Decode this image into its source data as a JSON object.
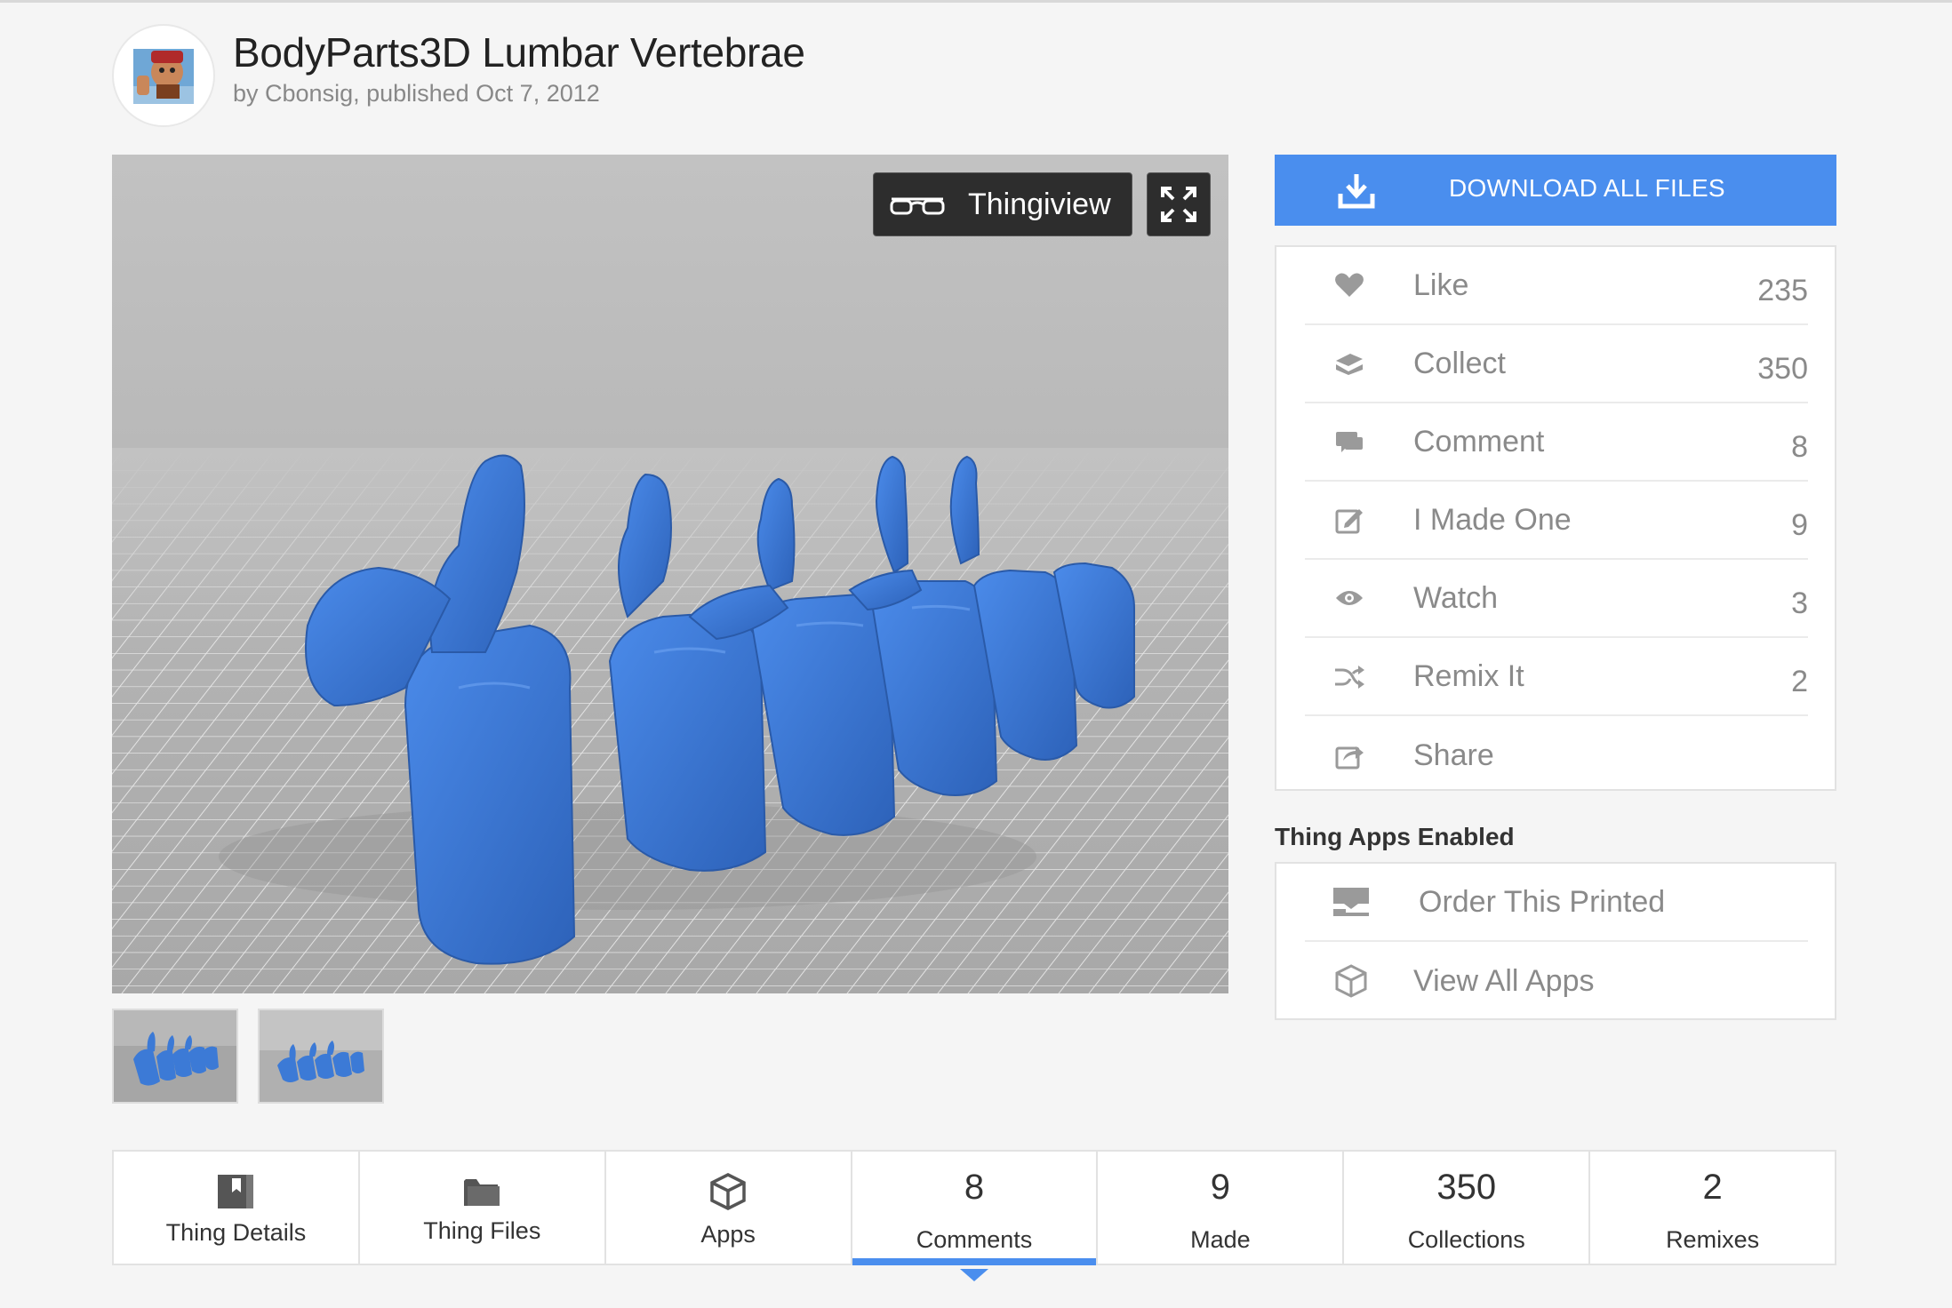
{
  "header": {
    "title": "BodyParts3D Lumbar Vertebrae",
    "byline": "by Cbonsig, published Oct 7, 2012"
  },
  "viewer": {
    "thingiview_label": "Thingiview",
    "model_color": "#3c7ad6"
  },
  "download": {
    "label": "DOWNLOAD ALL FILES",
    "color": "#4a8eee"
  },
  "actions": [
    {
      "label": "Like",
      "count": "235",
      "icon": "heart-icon"
    },
    {
      "label": "Collect",
      "count": "350",
      "icon": "collect-icon"
    },
    {
      "label": "Comment",
      "count": "8",
      "icon": "comment-icon"
    },
    {
      "label": "I Made One",
      "count": "9",
      "icon": "made-icon"
    },
    {
      "label": "Watch",
      "count": "3",
      "icon": "eye-icon"
    },
    {
      "label": "Remix It",
      "count": "2",
      "icon": "remix-icon"
    },
    {
      "label": "Share",
      "count": "",
      "icon": "share-icon"
    }
  ],
  "apps": {
    "heading": "Thing Apps Enabled",
    "items": [
      {
        "label": "Order This Printed",
        "icon": "printer-icon"
      },
      {
        "label": "View All Apps",
        "icon": "cube-icon"
      }
    ]
  },
  "tabs": [
    {
      "label": "Thing Details",
      "icon": "thing-details-icon",
      "number": ""
    },
    {
      "label": "Thing Files",
      "icon": "folder-icon",
      "number": ""
    },
    {
      "label": "Apps",
      "icon": "cube-icon",
      "number": ""
    },
    {
      "label": "Comments",
      "icon": "",
      "number": "8",
      "active": true
    },
    {
      "label": "Made",
      "icon": "",
      "number": "9"
    },
    {
      "label": "Collections",
      "icon": "",
      "number": "350"
    },
    {
      "label": "Remixes",
      "icon": "",
      "number": "2"
    }
  ]
}
